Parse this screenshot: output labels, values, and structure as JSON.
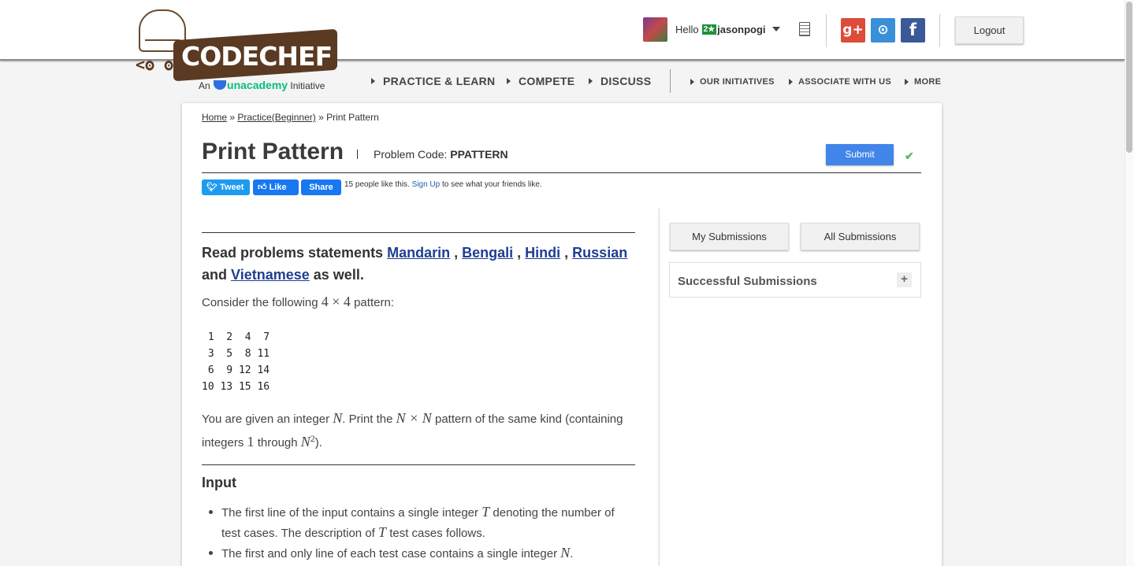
{
  "header": {
    "logo_text": "CODECHEF",
    "logo_tag_prefix": "An",
    "logo_tag_brand": "unacademy",
    "logo_tag_suffix": "Initiative",
    "hello": "Hello",
    "rating_badge": "2★",
    "username": "jasonpogi",
    "logout_label": "Logout",
    "social": {
      "gplus": "g+",
      "github": "⊙",
      "facebook": "f"
    }
  },
  "nav": {
    "primary": [
      "PRACTICE & LEARN",
      "COMPETE",
      "DISCUSS"
    ],
    "secondary": [
      "OUR INITIATIVES",
      "ASSOCIATE WITH US",
      "MORE"
    ]
  },
  "breadcrumb": {
    "home": "Home",
    "sep1": " » ",
    "practice": "Practice(Beginner)",
    "sep2": " » ",
    "current": "Print Pattern"
  },
  "problem": {
    "title": "Print Pattern",
    "code_label": "Problem Code:",
    "code": "PPATTERN",
    "submit_label": "Submit"
  },
  "share": {
    "tweet": "Tweet",
    "like": "Like",
    "share": "Share",
    "likes_count_text": "15 people like this.",
    "signup_link": "Sign Up",
    "friends_text": "to see what your friends like."
  },
  "statement": {
    "lang_prefix": "Read problems statements",
    "languages": [
      "Mandarin",
      "Bengali",
      "Hindi",
      "Russian"
    ],
    "lang_and": "and",
    "lang_last": "Vietnamese",
    "lang_suffix": "as well.",
    "consider_prefix": "Consider the following",
    "consider_dims": "4 × 4",
    "consider_suffix": "pattern:",
    "pattern": " 1  2  4  7\n 3  5  8 11\n 6  9 12 14\n10 13 15 16",
    "given_1": "You are given an integer",
    "given_n": "N",
    "given_2": ". Print the",
    "given_nxn": "N × N",
    "given_3": "pattern of the same kind (containing integers",
    "given_one": "1",
    "given_4": "through",
    "given_n2": "N",
    "given_exp": "2",
    "given_5": ").",
    "input_heading": "Input",
    "input_b1_1": "The first line of the input contains a single integer",
    "input_b1_t": "T",
    "input_b1_2": "denoting the number of test cases. The description of",
    "input_b1_t2": "T",
    "input_b1_3": "test cases follows.",
    "input_b2_1": "The first and only line of each test case contains a single integer",
    "input_b2_n": "N",
    "input_b2_2": "."
  },
  "sidebar": {
    "my_submissions": "My Submissions",
    "all_submissions": "All Submissions",
    "successful_submissions": "Successful Submissions",
    "expand": "+"
  }
}
